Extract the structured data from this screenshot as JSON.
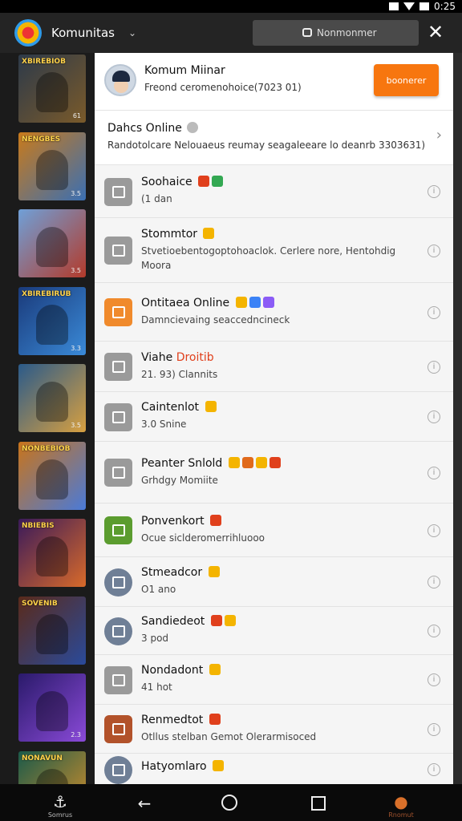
{
  "status": {
    "time": "0:25"
  },
  "appbar": {
    "title": "Komunitas",
    "search_label": "Nonmonmer"
  },
  "thumbs": [
    {
      "caption": "XBIREBIOB",
      "num": "61",
      "color1": "#2d3a4a",
      "color2": "#7a5a2a"
    },
    {
      "caption": "NENGBES",
      "num": "3.5",
      "color1": "#c97a1a",
      "color2": "#3a6fb3"
    },
    {
      "caption": "",
      "num": "3.5",
      "color1": "#6fa0d8",
      "color2": "#b33a2a"
    },
    {
      "caption": "XBIREBIRUB",
      "num": "3.3",
      "color1": "#1a3a7a",
      "color2": "#3a8ad8"
    },
    {
      "caption": "",
      "num": "3.5",
      "color1": "#2a5a8a",
      "color2": "#d8a040"
    },
    {
      "caption": "NONBEBIOB",
      "num": "",
      "color1": "#c9741a",
      "color2": "#4a7ad8"
    },
    {
      "caption": "NBIEBIS",
      "num": "",
      "color1": "#3a1a5a",
      "color2": "#d86a2a"
    },
    {
      "caption": "SOVENIB",
      "num": "",
      "color1": "#5a2a1a",
      "color2": "#2a4a9a"
    },
    {
      "caption": "",
      "num": "2.3",
      "color1": "#2a1a6a",
      "color2": "#8a4ad8"
    },
    {
      "caption": "NONAVUN",
      "num": "",
      "color1": "#1a5a4a",
      "color2": "#d8902a"
    }
  ],
  "header": {
    "name": "Komum Miinar",
    "subtitle": "Freond ceromenohoice(7023 01)",
    "button": "boonerer"
  },
  "online_section": {
    "title": "Dahcs Online",
    "subtitle": "Randotolcare Nelouaeus reumay seagaleeare lo deanrb 3303631)"
  },
  "rows": [
    {
      "name": "Soohaice",
      "suffix": "",
      "emojis": [
        "#e0401c",
        "#33a852"
      ],
      "sub": "(1 dan",
      "sub2": "",
      "icon": "gray"
    },
    {
      "name": "Stommtor",
      "suffix": "",
      "emojis": [
        "#f4b400"
      ],
      "sub": "Stvetioebentogoptohoaclok. Cerlere nore, Hentohdig",
      "sub2": "Moora",
      "icon": "gray"
    },
    {
      "name": "Ontitaea Online",
      "suffix": "",
      "emojis": [
        "#f4b400",
        "#3b82f6",
        "#8b5cf6"
      ],
      "sub": "Damncievaing seaccedncineck",
      "sub2": "",
      "icon": "orange"
    },
    {
      "name": "Viahe",
      "suffix": "Droitib",
      "emojis": [],
      "sub": "21. 93) Clannits",
      "sub2": "",
      "icon": "gray"
    },
    {
      "name": "Caintenlot",
      "suffix": "",
      "emojis": [
        "#f4b400"
      ],
      "sub": "3.0 Snine",
      "sub2": "",
      "icon": "gray"
    },
    {
      "name": "Peanter Snlold",
      "suffix": "",
      "emojis": [
        "#f4b400",
        "#e06a1c",
        "#f4b400",
        "#e0401c"
      ],
      "sub": "Grhdgy Momiite",
      "sub2": "",
      "icon": "gray"
    },
    {
      "name": "Ponvenkort",
      "suffix": "",
      "emojis": [
        "#e0401c"
      ],
      "sub": "Ocue siclderomerrihluooo",
      "sub2": "",
      "icon": "green"
    },
    {
      "name": "Stmeadcor",
      "suffix": "",
      "emojis": [
        "#f4b400"
      ],
      "sub": "O1 ano",
      "sub2": "",
      "icon": "pic"
    },
    {
      "name": "Sandiedeot",
      "suffix": "",
      "emojis": [
        "#e0401c",
        "#f4b400"
      ],
      "sub": "3 pod",
      "sub2": "",
      "icon": "pic"
    },
    {
      "name": "Nondadont",
      "suffix": "",
      "emojis": [
        "#f4b400"
      ],
      "sub": "41 hot",
      "sub2": "",
      "icon": "gray"
    },
    {
      "name": "Renmedtot",
      "suffix": "",
      "emojis": [
        "#e0401c"
      ],
      "sub": "Otllus stelban Gemot Olerarmisoced",
      "sub2": "",
      "icon": "red"
    },
    {
      "name": "Hatyomlaro",
      "suffix": "",
      "emojis": [
        "#f4b400"
      ],
      "sub": "",
      "sub2": "",
      "icon": "pic"
    }
  ],
  "navbar": {
    "left_label": "Somrus",
    "right_label": "Rnomut"
  },
  "colors": {
    "accent": "#f7760f",
    "appbar": "#242424"
  }
}
